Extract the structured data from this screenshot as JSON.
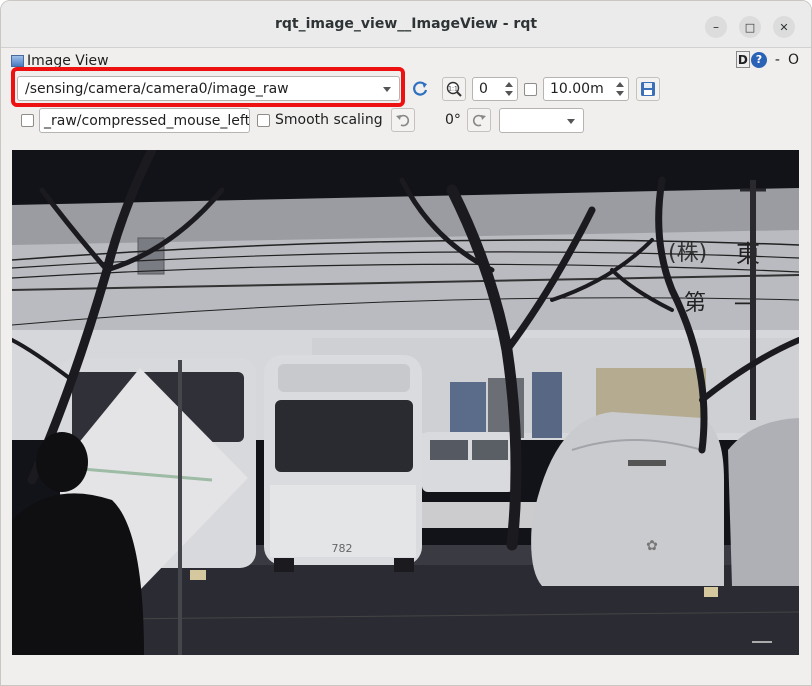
{
  "window": {
    "title": "rqt_image_view__ImageView - rqt",
    "minimize_glyph": "–",
    "maximize_glyph": "□",
    "close_glyph": "✕"
  },
  "plugin": {
    "title": "Image View",
    "d_button": "D",
    "help_glyph": "?",
    "dash": "-",
    "close": "O"
  },
  "toolbar": {
    "topic_value": "/sensing/camera/camera0/image_raw",
    "refresh_icon": "refresh-icon",
    "zoom_icon": "zoom-fit-icon",
    "spin_value": "0",
    "duration_value": "10.00m",
    "save_icon": "save-icon",
    "mouse_topic": "_raw/compressed_mouse_left",
    "smooth_label": "Smooth scaling",
    "rotation_value": "0°",
    "rotate_left_icon": "rotate-left-icon",
    "rotate_right_icon": "rotate-right-icon",
    "empty_combo": ""
  },
  "image": {
    "description_icon": "camera-image",
    "bus_number": "782"
  },
  "colors": {
    "highlight": "#ee1111",
    "image_bg": "#17171b"
  }
}
